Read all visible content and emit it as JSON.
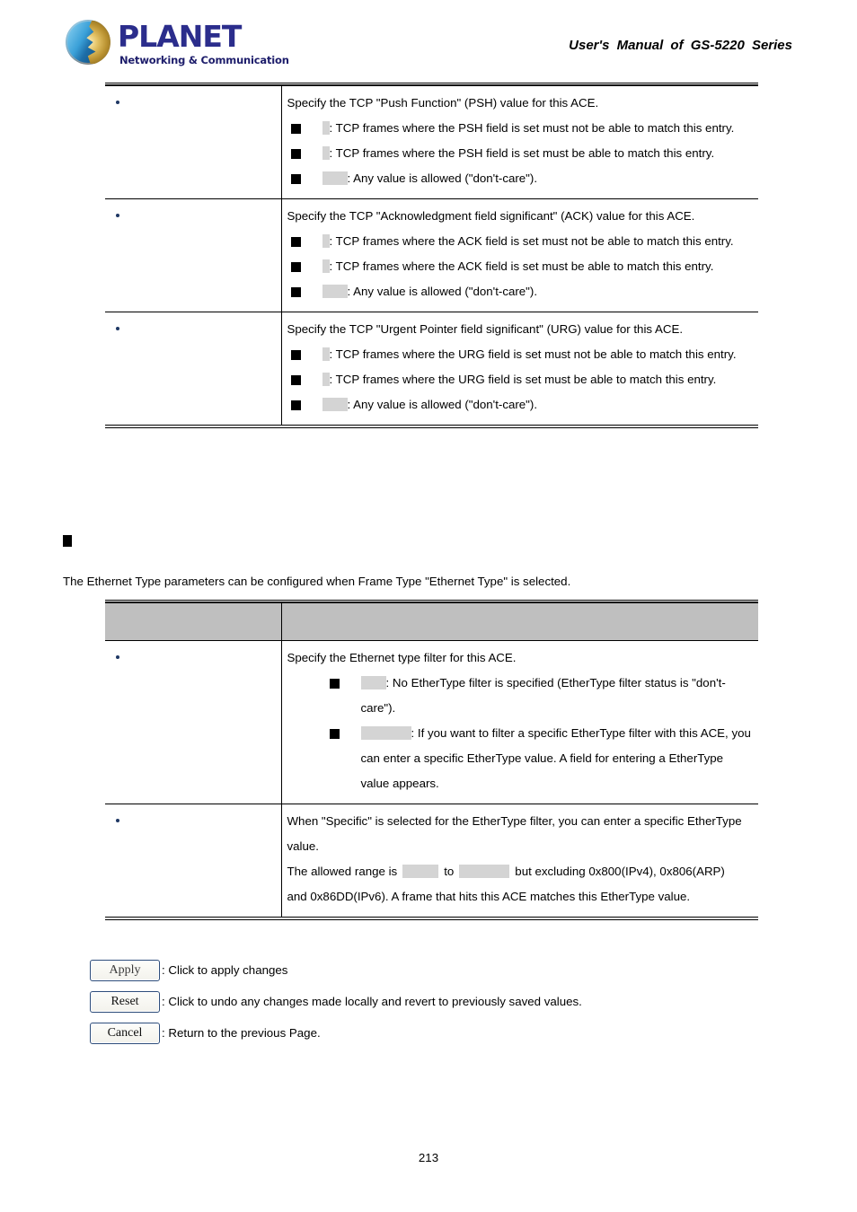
{
  "header": {
    "logo_word": "PLANET",
    "logo_tagline": "Networking & Communication",
    "title": "User's Manual of GS-5220 Series"
  },
  "tcp_flags_table": {
    "rows": [
      {
        "param_name": "",
        "intro": "Specify the TCP \"Push Function\" (PSH) value for this ACE.",
        "options": [
          {
            "value": "",
            "value_width": "w-xs",
            "text": ": TCP frames where the PSH field is set must not be able to match this entry."
          },
          {
            "value": "",
            "value_width": "w-xs",
            "text": ": TCP frames where the PSH field is set must be able to match this entry."
          },
          {
            "value": "",
            "value_width": "w-sm",
            "text": ": Any value is allowed (\"don't-care\")."
          }
        ]
      },
      {
        "param_name": "",
        "intro": "Specify the TCP \"Acknowledgment field significant\" (ACK) value for this ACE.",
        "options": [
          {
            "value": "",
            "value_width": "w-xs",
            "text": ": TCP frames where the ACK field is set must not be able to match this entry."
          },
          {
            "value": "",
            "value_width": "w-xs",
            "text": ": TCP frames where the ACK field is set must be able to match this entry."
          },
          {
            "value": "",
            "value_width": "w-sm",
            "text": ": Any value is allowed (\"don't-care\")."
          }
        ]
      },
      {
        "param_name": "",
        "intro": "Specify the TCP \"Urgent Pointer field significant\" (URG) value for this ACE.",
        "options": [
          {
            "value": "",
            "value_width": "w-xs",
            "text": ": TCP frames where the URG field is set must not be able to match this entry."
          },
          {
            "value": "",
            "value_width": "w-xs",
            "text": ": TCP frames where the URG field is set must be able to match this entry."
          },
          {
            "value": "",
            "value_width": "w-sm",
            "text": ": Any value is allowed (\"don't-care\")."
          }
        ]
      }
    ]
  },
  "ethernet_section": {
    "heading": "",
    "intro": "The Ethernet Type parameters can be configured when Frame Type \"Ethernet Type\" is selected."
  },
  "ethernet_table": {
    "headers": {
      "col_name": "",
      "col_desc": ""
    },
    "row1": {
      "param_name": "",
      "intro": "Specify the Ethernet type filter for this ACE.",
      "options": [
        {
          "value": "",
          "value_width": "w-sm",
          "text": ": No EtherType filter is specified (EtherType filter status is \"don't-care\")."
        },
        {
          "value": "",
          "value_width": "w-lg",
          "text": ": If you want to filter a specific EtherType filter with this ACE, you can enter a specific EtherType value. A field for entering a EtherType value appears."
        }
      ]
    },
    "row2": {
      "param_name": "",
      "line1": "When \"Specific\" is selected for the EtherType filter, you can enter a specific EtherType value.",
      "range_prefix": "The allowed range is",
      "range_min": "",
      "range_to": "to",
      "range_max": "",
      "range_suffix": "but excluding 0x800(IPv4), 0x806(ARP)",
      "line3": "and 0x86DD(IPv6). A frame that hits this ACE matches this EtherType value."
    }
  },
  "buttons": [
    {
      "label": "Apply",
      "caption": ": Click to apply changes"
    },
    {
      "label": "Reset",
      "caption": ": Click to undo any changes made locally and revert to previously saved values."
    },
    {
      "label": "Cancel",
      "caption": ": Return to the previous Page."
    }
  ],
  "footer": {
    "page_number": "213"
  }
}
